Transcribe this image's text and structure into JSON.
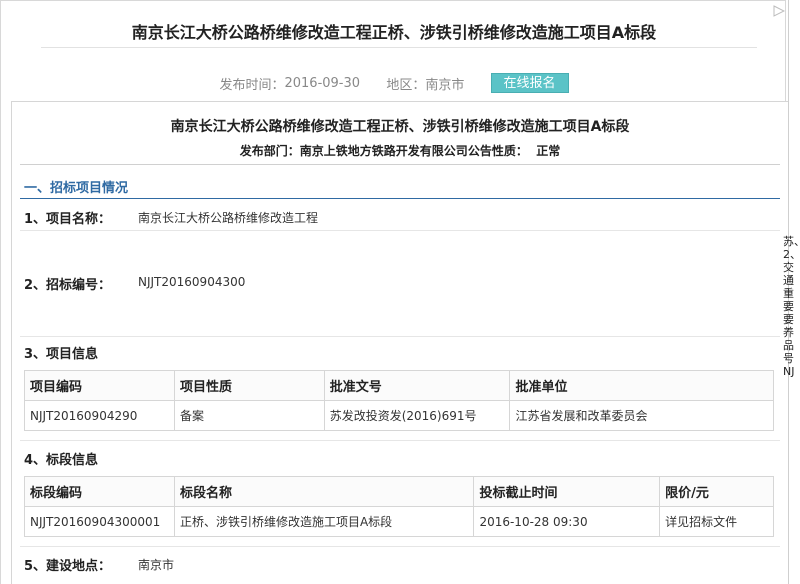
{
  "page": {
    "title": "南京长江大桥公路桥维修改造工程正桥、涉铁引桥维修改造施工项目A标段"
  },
  "meta": {
    "publish_label": "发布时间：",
    "publish_date": "2016-09-30",
    "region_label": "地区：",
    "region": "南京市",
    "signup_button": "在线报名"
  },
  "notice": {
    "title": "南京长江大桥公路桥维修改造工程正桥、涉铁引桥维修改造施工项目A标段",
    "dept_label": "发布部门：",
    "dept": "南京上铁地方铁路开发有限公司",
    "nature_label": "公告性质：",
    "nature": "正常"
  },
  "section1": {
    "heading": "一、招标项目情况",
    "project_name_label": "1、项目名称：",
    "project_name": "南京长江大桥公路桥维修改造工程",
    "bid_no_label": "2、招标编号：",
    "bid_no": "NJJT20160904300",
    "project_info_label": "3、项目信息",
    "project_table": {
      "headers": [
        "项目编码",
        "项目性质",
        "批准文号",
        "批准单位"
      ],
      "rows": [
        [
          "NJJT20160904290",
          "备案",
          "苏发改投资发(2016)691号",
          "江苏省发展和改革委员会"
        ]
      ]
    },
    "lot_info_label": "4、标段信息",
    "lot_table": {
      "headers": [
        "标段编码",
        "标段名称",
        "投标截止时间",
        "限价/元"
      ],
      "rows": [
        [
          "NJJT20160904300001",
          "正桥、涉铁引桥维修改造施工项目A标段",
          "2016-10-28 09:30",
          "详见招标文件"
        ]
      ]
    },
    "location_label": "5、建设地点：",
    "location": "南京市"
  },
  "side": {
    "text": "苏、2、交通重要要养品号NJ"
  }
}
